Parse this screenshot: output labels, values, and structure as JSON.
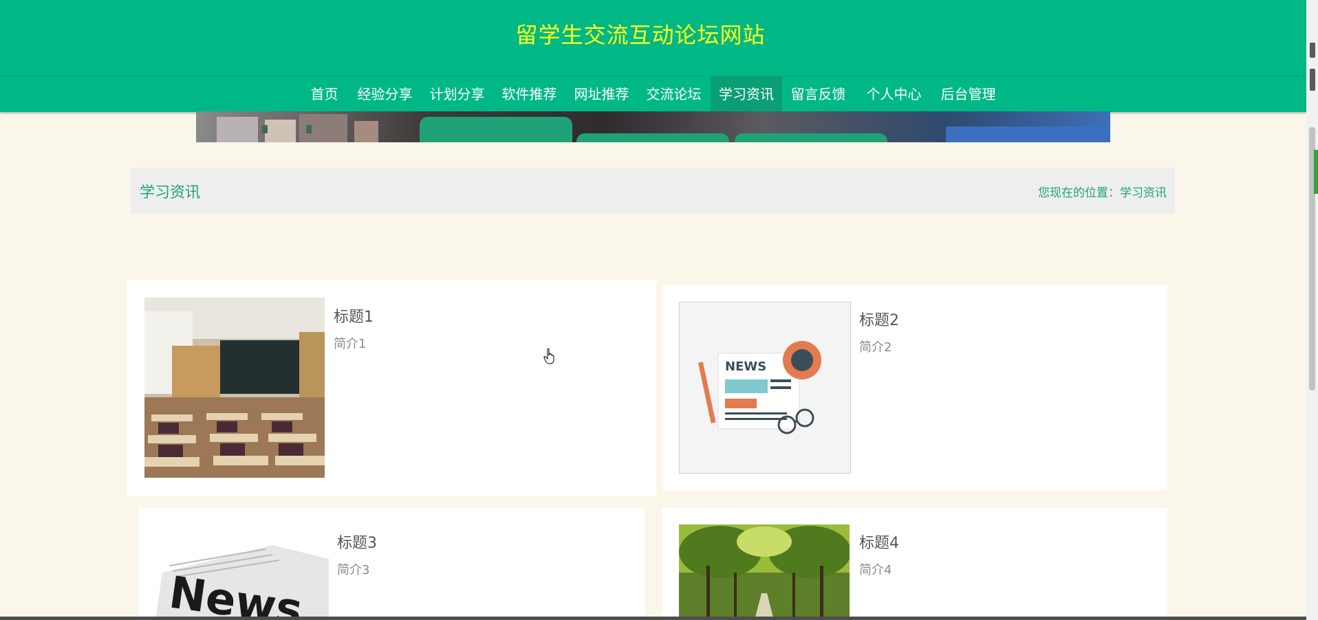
{
  "site": {
    "title": "留学生交流互动论坛网站"
  },
  "nav": {
    "items": [
      {
        "label": "首页"
      },
      {
        "label": "经验分享"
      },
      {
        "label": "计划分享"
      },
      {
        "label": "软件推荐"
      },
      {
        "label": "网址推荐"
      },
      {
        "label": "交流论坛"
      },
      {
        "label": "学习资讯",
        "active": true
      },
      {
        "label": "留言反馈"
      },
      {
        "label": "个人中心"
      },
      {
        "label": "后台管理"
      }
    ]
  },
  "section": {
    "title": "学习资讯",
    "location_label": "您现在的位置：",
    "location_value": "学习资讯"
  },
  "cards": [
    {
      "title": "标题1",
      "desc": "简介1",
      "image": "classroom-photo"
    },
    {
      "title": "标题2",
      "desc": "简介2",
      "image": "news-illustration"
    },
    {
      "title": "标题3",
      "desc": "简介3",
      "image": "newspaper-photo"
    },
    {
      "title": "标题4",
      "desc": "简介4",
      "image": "tree-lined-path-photo"
    }
  ],
  "colors": {
    "header": "#00b886",
    "title_text": "#ffff1a",
    "accent": "#1ca37c",
    "page_bg": "#faf6ea"
  }
}
